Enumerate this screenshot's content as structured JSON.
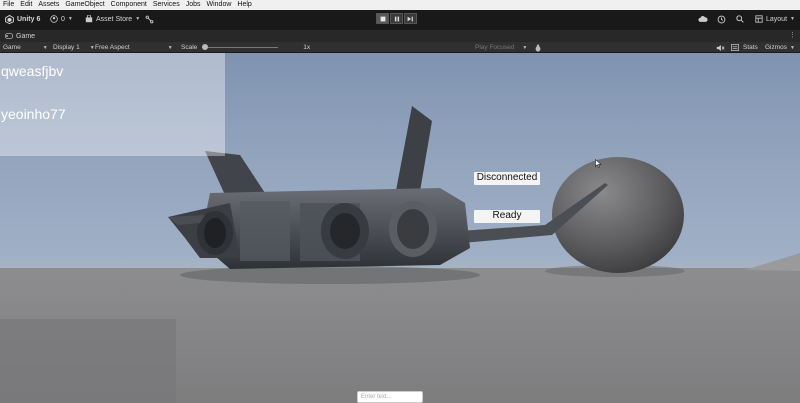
{
  "menu": [
    "File",
    "Edit",
    "Assets",
    "GameObject",
    "Component",
    "Services",
    "Jobs",
    "Window",
    "Help"
  ],
  "toolbar": {
    "unity_label": "Unity 6",
    "account_count": "0",
    "asset_store": "Asset Store",
    "layout": "Layout"
  },
  "tab": {
    "title": "Game"
  },
  "gamebar": {
    "mode": "Game",
    "display": "Display 1",
    "aspect": "Free Aspect",
    "scale_label": "Scale",
    "scale_value": "1x",
    "play_focused": "Play Focused",
    "stats": "Stats",
    "gizmos": "Gizmos"
  },
  "game_ui": {
    "player_one": "qweasfjbv",
    "player_two": "yeoinho77",
    "status": "Disconnected",
    "ready_button": "Ready",
    "input_placeholder": "Enter text..."
  },
  "colors": {
    "sky_top": "#7f93b0",
    "ground": "#858586",
    "panel": "#191919"
  }
}
